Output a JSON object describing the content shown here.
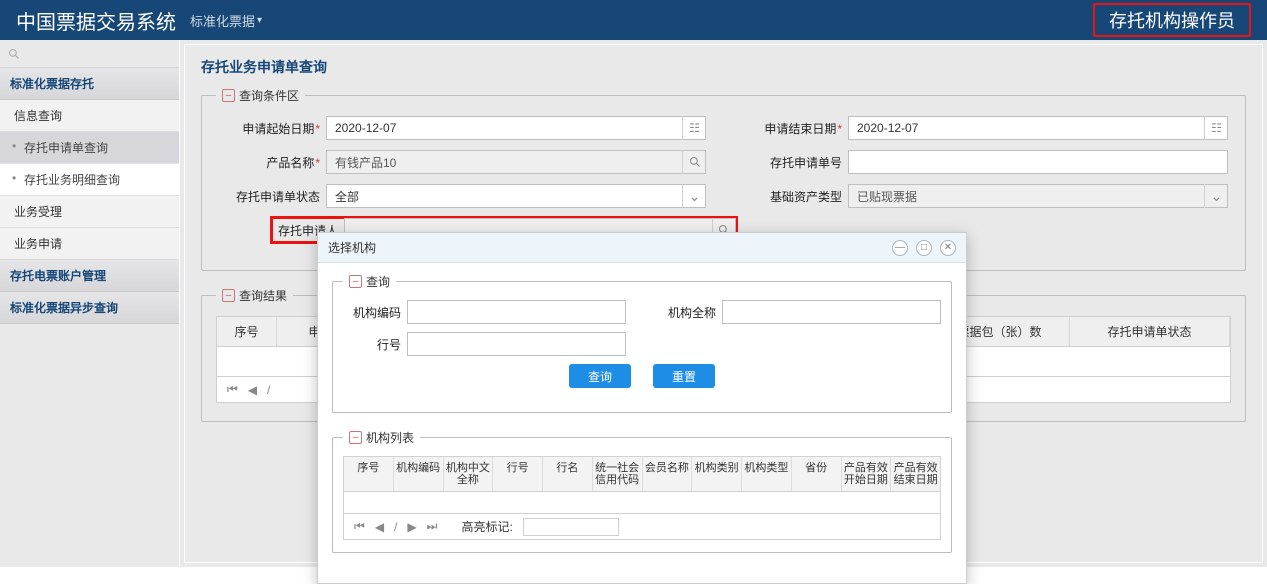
{
  "header": {
    "app_title": "中国票据交易系统",
    "menu_label": "标准化票据",
    "user_role": "存托机构操作员"
  },
  "sidebar": {
    "cat1": "标准化票据存托",
    "sec_info": "信息查询",
    "item_apply": "存托申请单查询",
    "item_detail": "存托业务明细查询",
    "sec_accept": "业务受理",
    "sec_apply": "业务申请",
    "cat2": "存托电票账户管理",
    "cat3": "标准化票据异步查询"
  },
  "page": {
    "title": "存托业务申请单查询",
    "cond_legend": "查询条件区",
    "result_legend": "查询结果"
  },
  "form": {
    "start_date_label": "申请起始日期",
    "start_date": "2020-12-07",
    "end_date_label": "申请结束日期",
    "end_date": "2020-12-07",
    "product_label": "产品名称",
    "product": "有钱产品10",
    "apply_no_label": "存托申请单号",
    "apply_no": "",
    "status_label": "存托申请单状态",
    "status": "全部",
    "asset_label": "基础资产类型",
    "asset": "已贴现票据",
    "applicant_label": "存托申请人",
    "applicant": ""
  },
  "result_cols": {
    "c0": "序号",
    "c1": "申请日",
    "c2": "票据包（张）数",
    "c3": "存托申请单状态"
  },
  "pager_sep": "/",
  "dialog": {
    "title": "选择机构",
    "q_legend": "查询",
    "list_legend": "机构列表",
    "org_code_label": "机构编码",
    "org_name_label": "机构全称",
    "bank_no_label": "行号",
    "btn_query": "查询",
    "btn_reset": "重置",
    "cols": {
      "c0": "序号",
      "c1": "机构编码",
      "c2": "机构中文全称",
      "c3": "行号",
      "c4": "行名",
      "c5": "统一社会信用代码",
      "c6": "会员名称",
      "c7": "机构类别",
      "c8": "机构类型",
      "c9": "省份",
      "c10": "产品有效开始日期",
      "c11": "产品有效结束日期"
    },
    "pager_sep": "/",
    "highlight_label": "高亮标记:"
  }
}
